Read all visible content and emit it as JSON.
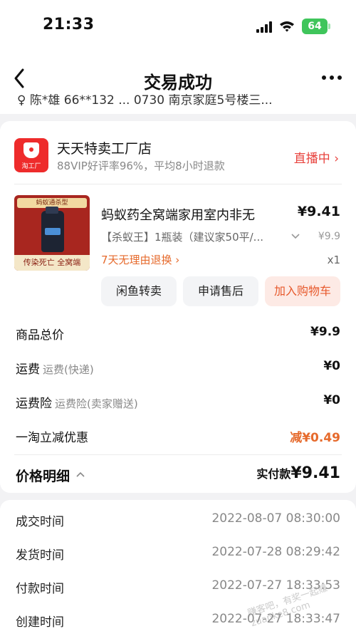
{
  "status_bar": {
    "time": "21:33",
    "battery": "64"
  },
  "header": {
    "title": "交易成功"
  },
  "address": {
    "line": "♀ 陈*雄 66**132 ... 0730 南京家庭5号楼三..."
  },
  "shop": {
    "logo_text": "淘工厂",
    "name": "天天特卖工厂店",
    "subtitle": "88VIP好评率96%，平均8小时退款",
    "live_label": "直播中 ›"
  },
  "product": {
    "image_top_text": "蚂蚁通杀型",
    "image_band_text": "传染死亡 全窝端",
    "title": "蚂蚁药全窝端家用室内非无",
    "price": "¥9.41",
    "spec": "【杀蚁王】1瓶装（建议家50平/...",
    "original_price": "¥9.9",
    "return_policy": "7天无理由退换 ›",
    "quantity": "x1"
  },
  "actions": {
    "resell": "闲鱼转卖",
    "after_sale": "申请售后",
    "add_cart": "加入购物车"
  },
  "summary": {
    "goods_total_label": "商品总价",
    "goods_total_value": "¥9.9",
    "shipping_label": "运费",
    "shipping_sub": "运费(快递)",
    "shipping_value": "¥0",
    "insurance_label": "运费险",
    "insurance_sub": "运费险(卖家赠送)",
    "insurance_value": "¥0",
    "discount_label": "一淘立减优惠",
    "discount_value": "减¥0.49",
    "price_detail_label": "价格明细",
    "paid_label": "实付款",
    "paid_value": "¥9.41"
  },
  "times": [
    {
      "label": "成交时间",
      "value": "2022-08-07 08:30:00"
    },
    {
      "label": "发货时间",
      "value": "2022-07-28 08:29:42"
    },
    {
      "label": "付款时间",
      "value": "2022-07-27 18:33:53"
    },
    {
      "label": "创建时间",
      "value": "2022-07-27 18:33:47"
    }
  ],
  "watermark": "赚客吧，有奖一起赚 zuanke8.com",
  "colors": {
    "accent": "#e66a2c",
    "live": "#e8433e",
    "battery": "#3fc55b",
    "shop_logo": "#ee2b2b"
  }
}
